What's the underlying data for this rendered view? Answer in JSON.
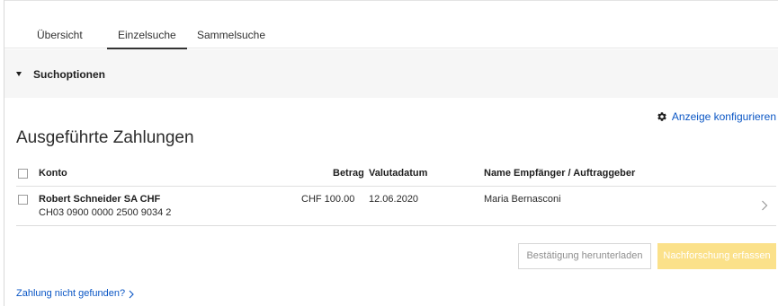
{
  "tabs": [
    {
      "label": "Übersicht"
    },
    {
      "label": "Einzelsuche"
    },
    {
      "label": "Sammelsuche"
    }
  ],
  "active_tab": "Einzelsuche",
  "search_options": {
    "label": "Suchoptionen"
  },
  "config_link": {
    "label": "Anzeige konfigurieren",
    "icon": "gear-icon"
  },
  "section": {
    "title": "Ausgeführte Zahlungen"
  },
  "table": {
    "columns": {
      "account": "Konto",
      "amount": "Betrag",
      "value_date": "Valutadatum",
      "party": "Name Empfänger / Auftraggeber"
    },
    "rows": [
      {
        "account_name": "Robert Schneider SA CHF",
        "account_iban": "CH03 0900 0000 2500 9034 2",
        "amount": "CHF 100.00",
        "value_date": "12.06.2020",
        "party": "Maria Bernasconi"
      }
    ]
  },
  "buttons": {
    "download_confirmation": "Bestätigung herunterladen",
    "create_inquiry": "Nachforschung erfassen"
  },
  "not_found_link": {
    "label": "Zahlung nicht gefunden?"
  },
  "colors": {
    "link": "#0a56c5",
    "primary_button": "#fbe18a",
    "options_bg": "#f6f6f6"
  }
}
